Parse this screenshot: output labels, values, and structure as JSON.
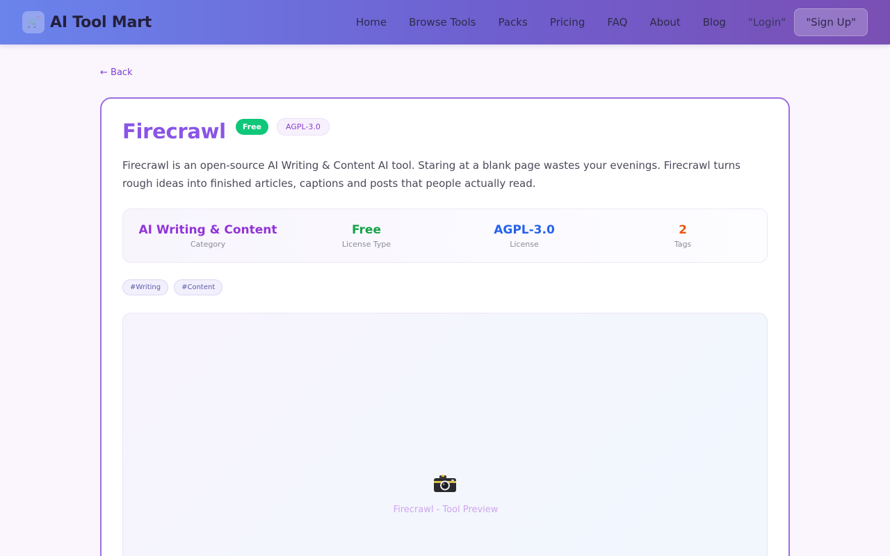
{
  "header": {
    "brand_icon": "cart-icon",
    "brand_glyph": "🛒",
    "brand_name": "AI Tool Mart",
    "nav": [
      "Home",
      "Browse Tools",
      "Packs",
      "Pricing",
      "FAQ",
      "About",
      "Blog"
    ],
    "login_label": "\"Login\"",
    "signup_label": "\"Sign Up\""
  },
  "back_label": "← Back",
  "tool": {
    "name": "Firecrawl",
    "price_badge": "Free",
    "license_badge": "AGPL-3.0",
    "description": "Firecrawl is an open-source AI Writing & Content AI tool. Staring at a blank page wastes your evenings. Firecrawl turns rough ideas into finished articles, captions and posts that people actually read.",
    "stats": [
      {
        "value": "AI Writing & Content",
        "label": "Category",
        "color": "#9234d8"
      },
      {
        "value": "Free",
        "label": "License Type",
        "color": "#16a34a"
      },
      {
        "value": "AGPL-3.0",
        "label": "License",
        "color": "#2563eb"
      },
      {
        "value": "2",
        "label": "Tags",
        "color": "#ea580c"
      }
    ],
    "tags": [
      "#Writing",
      "#Content"
    ],
    "preview": {
      "icon": "camera-icon",
      "caption": "Firecrawl - Tool Preview"
    }
  },
  "colors": {
    "accent": "#8a55e6",
    "free_badge": "#0ec779",
    "header_start": "#6a84ec",
    "header_end": "#7a4fb4"
  }
}
